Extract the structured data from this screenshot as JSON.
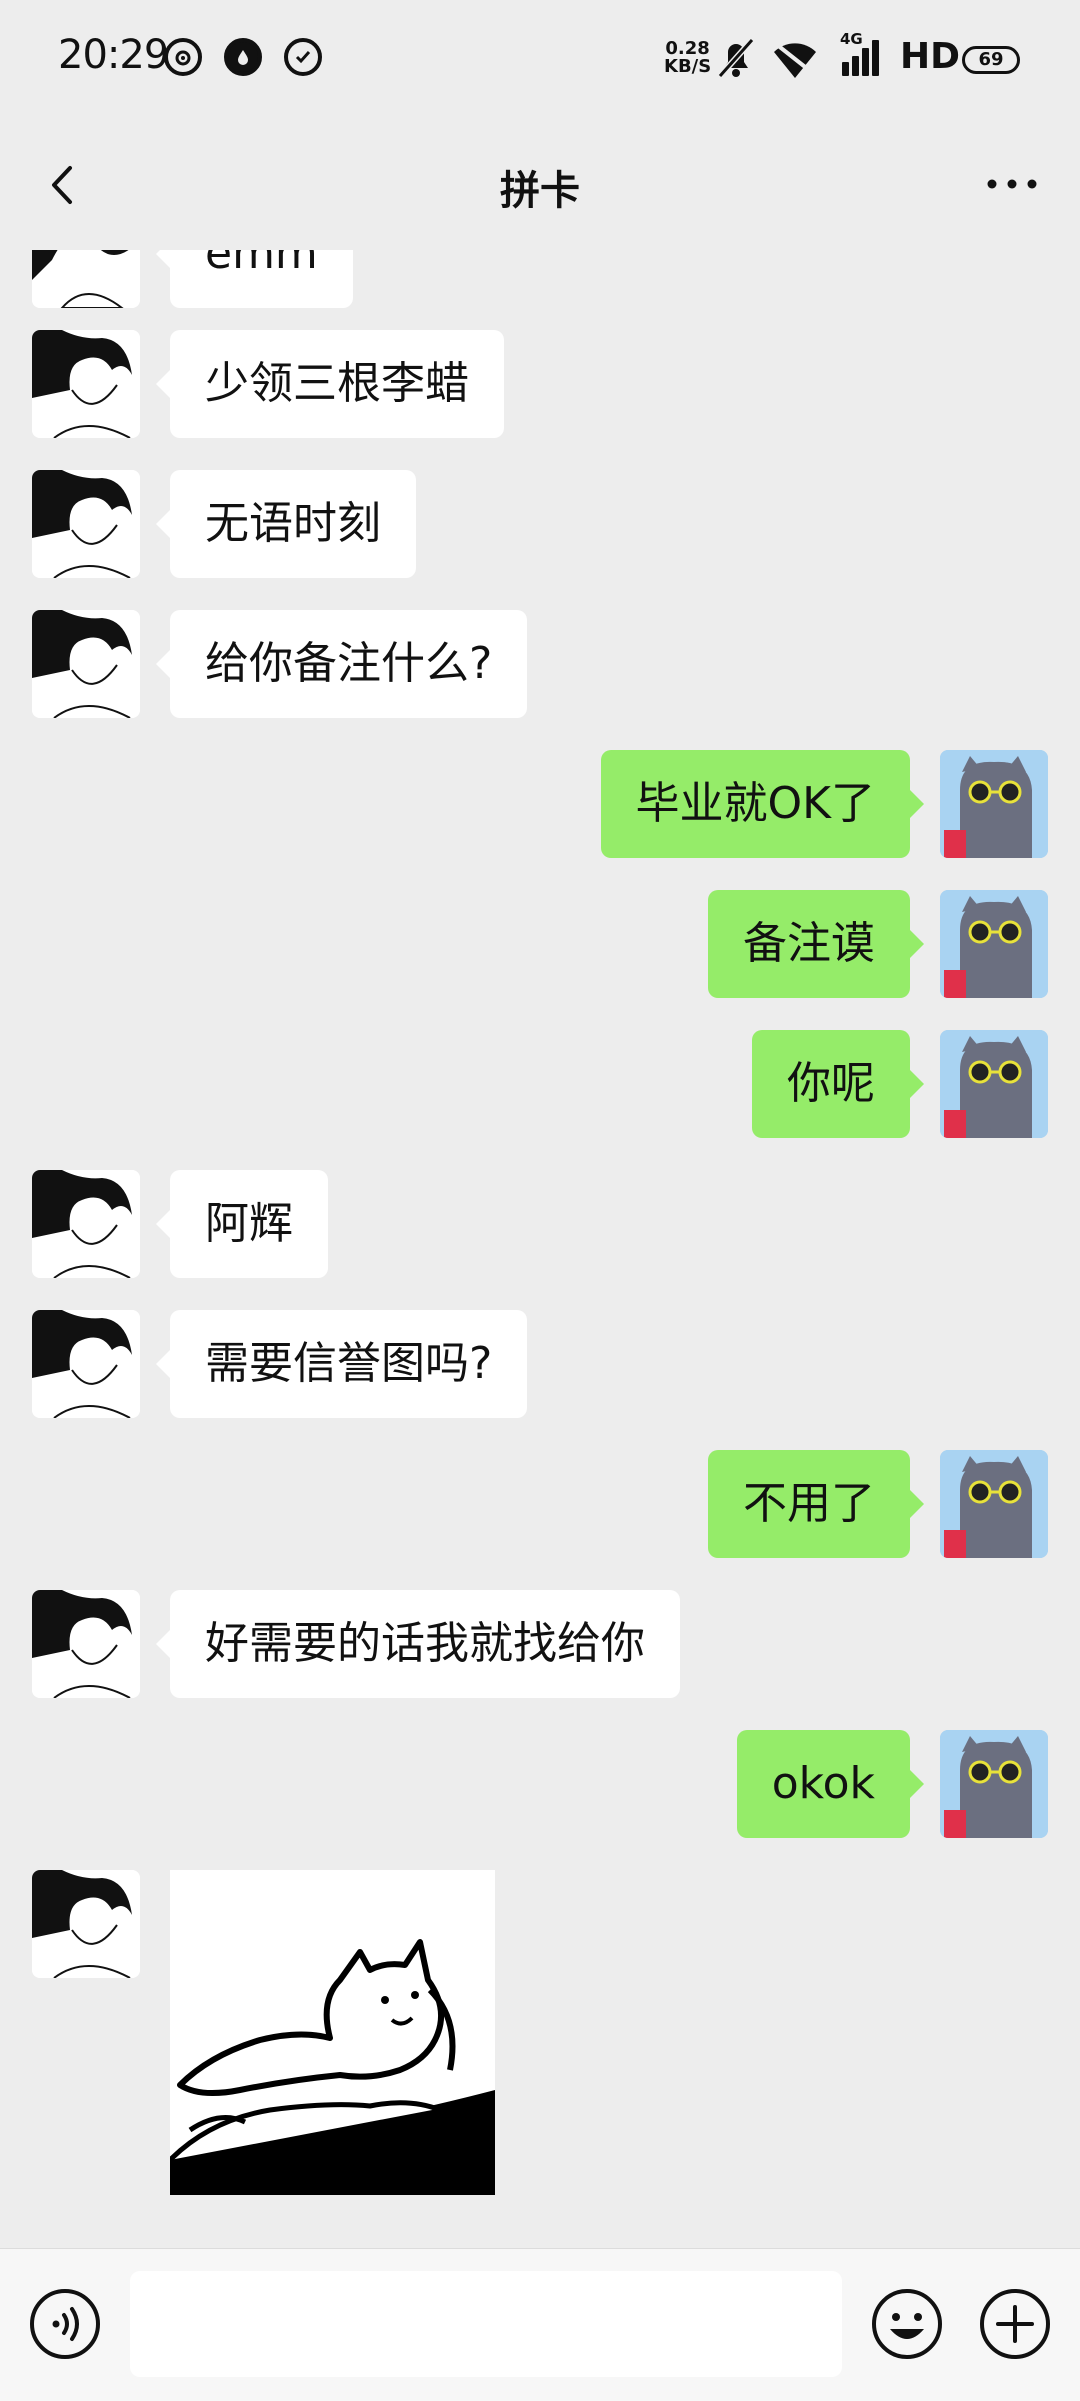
{
  "status_bar": {
    "time": "20:29",
    "net_speed_value": "0.28",
    "net_speed_unit": "KB/S",
    "signal_type": "4G",
    "hd_label": "HD",
    "battery": "69",
    "icons": [
      "weibo-icon",
      "drop-icon",
      "check-circle-icon",
      "mute-icon",
      "wifi-icon",
      "signal-icon",
      "battery-icon"
    ]
  },
  "header": {
    "title": "拼卡",
    "back_icon": "chevron-left-icon",
    "more_icon": "more-dots-icon"
  },
  "messages": [
    {
      "side": "in",
      "text": "emm"
    },
    {
      "side": "in",
      "text": "少领三根李蜡"
    },
    {
      "side": "in",
      "text": "无语时刻"
    },
    {
      "side": "in",
      "text": "给你备注什么?"
    },
    {
      "side": "out",
      "text": "毕业就OK了"
    },
    {
      "side": "out",
      "text": "备注谟"
    },
    {
      "side": "out",
      "text": "你呢"
    },
    {
      "side": "in",
      "text": "阿辉"
    },
    {
      "side": "in",
      "text": "需要信誉图吗?"
    },
    {
      "side": "out",
      "text": "不用了"
    },
    {
      "side": "in",
      "text": "好需要的话我就找给你"
    },
    {
      "side": "out",
      "text": "okok"
    },
    {
      "side": "in",
      "type": "sticker",
      "sticker": "lying-cat-sticker"
    }
  ],
  "input_bar": {
    "voice_icon": "voice-icon",
    "input_value": "",
    "emoji_icon": "emoji-icon",
    "plus_icon": "plus-icon"
  },
  "colors": {
    "background": "#ededed",
    "outgoing_bubble": "#95ec69",
    "incoming_bubble": "#ffffff"
  }
}
